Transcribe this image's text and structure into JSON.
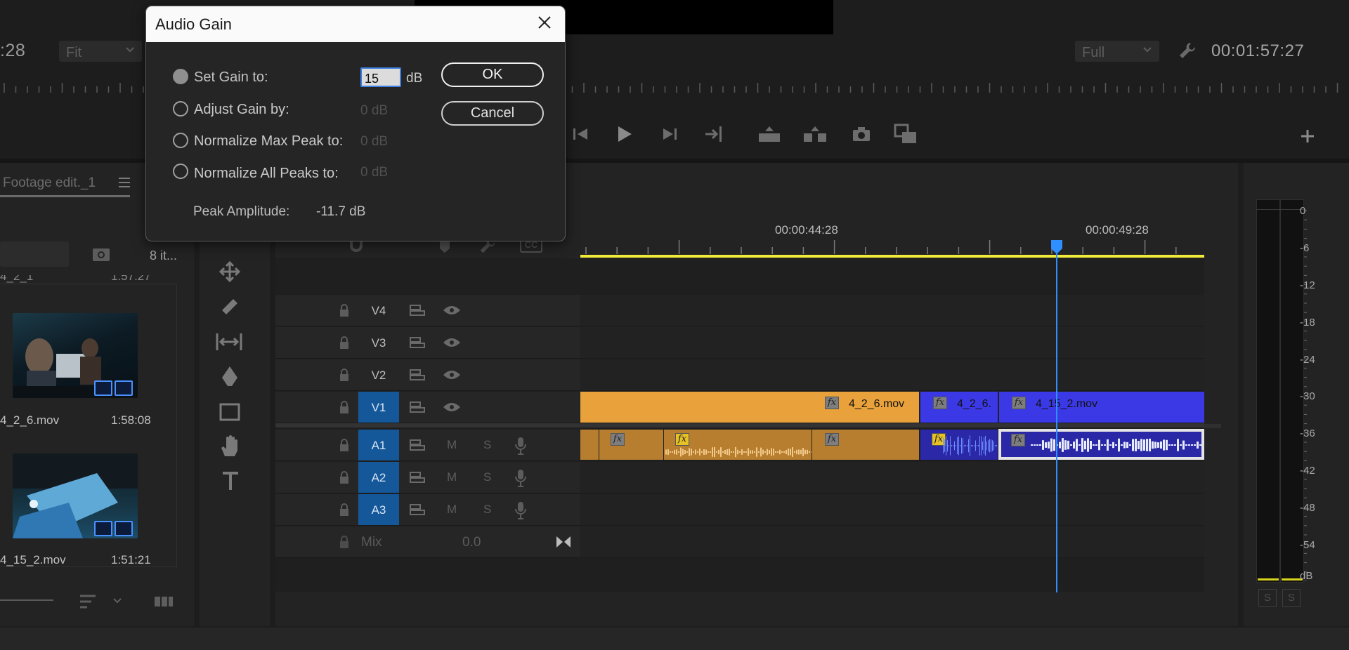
{
  "monitor": {
    "left_timecode": ":28",
    "left_fit": "Fit",
    "right_quality": "Full",
    "right_timecode": "00:01:57:27"
  },
  "project": {
    "tab_title": "Footage edit._1",
    "items_count": "8 it...",
    "partial_top_name": "4_2_1",
    "partial_top_duration": "1:57:27",
    "clips": [
      {
        "name": "4_2_6.mov",
        "duration": "1:58:08"
      },
      {
        "name": "4_15_2.mov",
        "duration": "1:51:21"
      }
    ]
  },
  "timeline": {
    "ruler_labels": [
      "00:00:44:28",
      "00:00:49:28"
    ],
    "video_tracks": [
      "V4",
      "V3",
      "V2",
      "V1"
    ],
    "audio_tracks": [
      "A1",
      "A2",
      "A3"
    ],
    "mute_label": "M",
    "solo_label": "S",
    "mix": {
      "label": "Mix",
      "value": "0.0"
    },
    "clips": {
      "v1_orange": "4_2_6.mov",
      "v1_blue_short": "4_2_6.",
      "v1_blue_long": "4_15_2.mov"
    },
    "fx_label": "fx"
  },
  "meter": {
    "scale": [
      "0",
      "-6",
      "-12",
      "-18",
      "-24",
      "-30",
      "-36",
      "-42",
      "-48",
      "-54",
      "dB"
    ],
    "solo_buttons": [
      "S",
      "S"
    ]
  },
  "dialog": {
    "title": "Audio Gain",
    "options": [
      {
        "label": "Set Gain to:",
        "selected": true
      },
      {
        "label": "Adjust Gain by:",
        "value": "0 dB"
      },
      {
        "label": "Normalize Max Peak to:",
        "value": "0 dB"
      },
      {
        "label": "Normalize All Peaks to:",
        "value": "0 dB"
      }
    ],
    "gain_value": "15",
    "gain_unit": "dB",
    "ok_label": "OK",
    "cancel_label": "Cancel",
    "peak_label": "Peak Amplitude:",
    "peak_value": "-11.7 dB"
  },
  "colors": {
    "playhead": "#2f8fff",
    "clip_orange": "#e9a23b",
    "clip_blue": "#3b39e6",
    "track_selected": "#14589a",
    "work_area": "#f2ea3a"
  }
}
